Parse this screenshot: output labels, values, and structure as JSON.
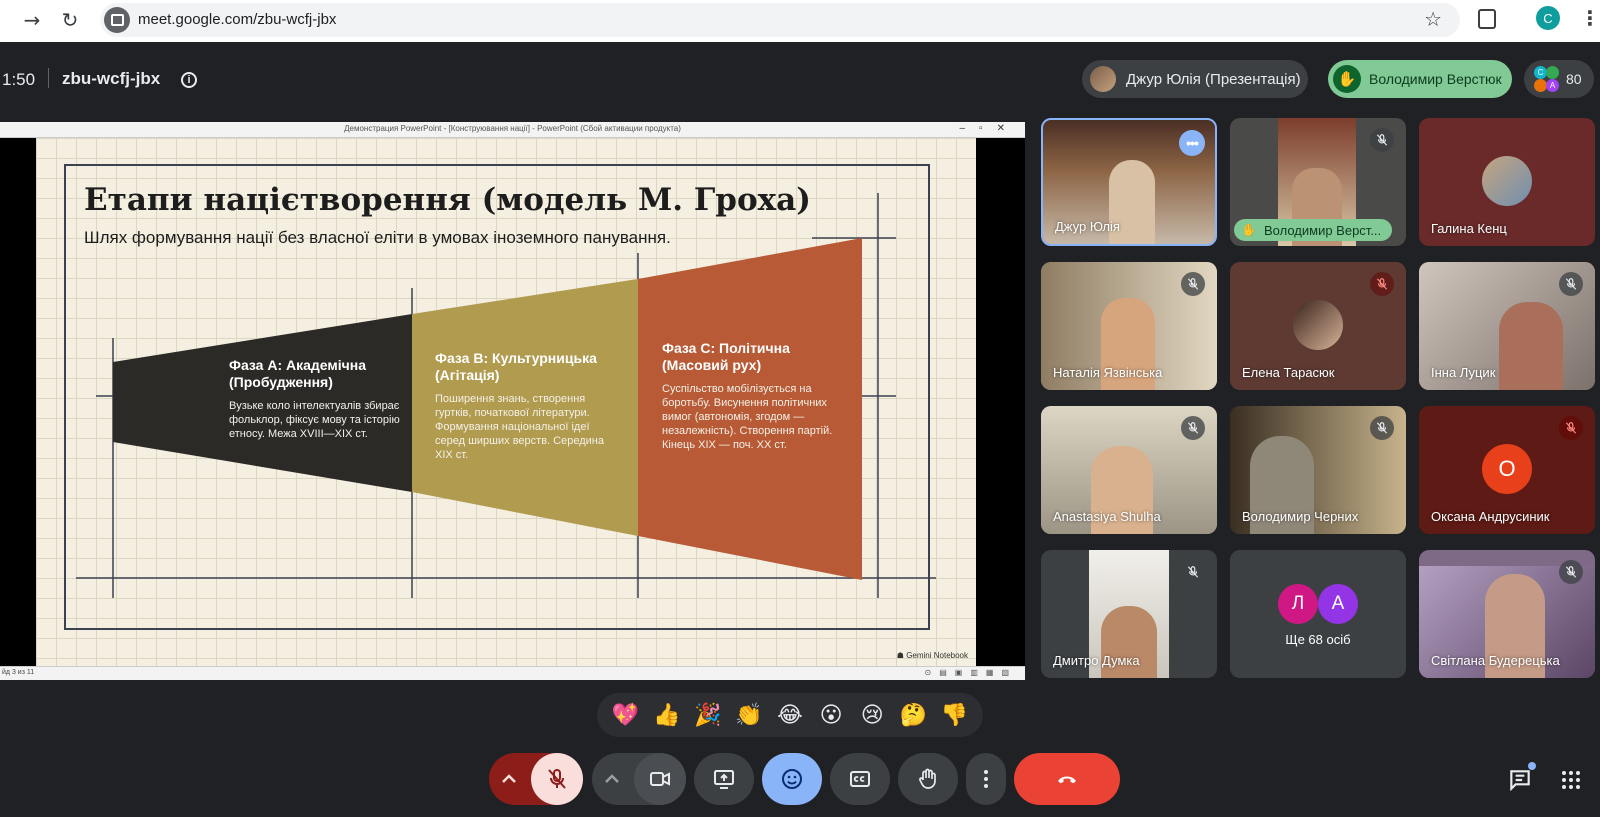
{
  "browser": {
    "url": "meet.google.com/zbu-wcfj-jbx",
    "back": "→",
    "reload": "↻",
    "star": "☆",
    "profile_initial": "C",
    "menu": "⋮"
  },
  "meeting": {
    "time": "1:50",
    "code": "zbu-wcfj-jbx",
    "info": "i",
    "presenter_chip": "Джур Юлія (Презентація)",
    "raised_hand_chip": "Володимир Верстюк",
    "participant_count": "80",
    "mini_avatars": [
      "C",
      "A"
    ]
  },
  "presentation": {
    "window_title": "Демонстрация PowerPoint - [Конструювання нації] - PowerPoint (Сбой активации продукта)",
    "window_buttons": "–▫✕",
    "slide_title": "Етапи націєтворення (модель М. Гроха)",
    "slide_subtitle": "Шлях формування нації без власної еліти в умовах іноземного панування.",
    "phases": [
      {
        "title": "Фаза A: Академічна (Пробудження)",
        "body": "Вузьке коло інтелектуалів збирає фольклор, фіксує мову та історію етносу. Межа XVIII—XIX ст.",
        "color": "#2b2a27"
      },
      {
        "title": "Фаза B: Культурницька (Агітація)",
        "body": "Поширення знань, створення гуртків, початкової літератури. Формування національної ідеї серед ширших верств. Середина XIX ст.",
        "color": "#b19b4f"
      },
      {
        "title": "Фаза C: Політична (Масовий рух)",
        "body": "Суспільство мобілізується на боротьбу. Висунення політичних вимог (автономія, згодом — незалежність). Створення партій. Кінець XIX — поч. XX ст.",
        "color": "#b85a35"
      }
    ],
    "watermark": "☗ Gemini Notebook",
    "status_text": "йд 3 из 11",
    "view_icons": "⊙▤▣▥▦▧"
  },
  "participants": [
    {
      "name": "Джур Юлія",
      "bg": "#6b5548",
      "active": true
    },
    {
      "name": "Володимир Верст...",
      "bg": "#4a4a48",
      "hand": true
    },
    {
      "name": "Галина Кенц",
      "bg": "#6a2a2a",
      "avatar": "photo"
    },
    {
      "name": "Наталія Язвінська",
      "bg": "#b6a48a"
    },
    {
      "name": "Елена Тарасюк",
      "bg": "#5e3a33",
      "avatar": "photo",
      "mic_red": true
    },
    {
      "name": "Інна Луцик",
      "bg": "#9d928a"
    },
    {
      "name": "Anastasiya Shulha",
      "bg": "#b8b2a6"
    },
    {
      "name": "Володимир Черних",
      "bg": "#5a4c3c"
    },
    {
      "name": "Оксана Андрусиник",
      "bg": "#5e1a14",
      "letter": "О",
      "letter_bg": "#e8401a"
    },
    {
      "name": "Дмитро Думка",
      "bg": "#3c4043"
    },
    {
      "name": "Ще 68 осіб",
      "bg": "#3c4043",
      "letters": [
        "Л",
        "А"
      ]
    },
    {
      "name": "Світлана Будерецька",
      "bg": "#7e6a86"
    }
  ],
  "reactions": [
    "💖",
    "👍",
    "🎉",
    "👏",
    "😂",
    "😮",
    "😢",
    "🤔",
    "👎"
  ],
  "colors": {
    "accent_blue": "#8ab4f8",
    "hangup_red": "#ea4335",
    "hand_green": "#81c995",
    "mic_off_dark": "#8c1d18",
    "mic_off_light": "#f9dedc"
  }
}
